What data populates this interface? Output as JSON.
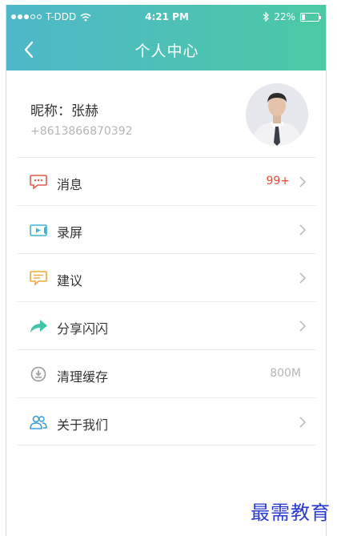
{
  "status_bar": {
    "carrier": "T-DDD",
    "time": "4:21 PM",
    "battery": "22%",
    "battery_level": 0.22
  },
  "navbar": {
    "title": "个人中心",
    "back_icon": "chevron-left-icon"
  },
  "profile": {
    "nickname_label": "昵称：",
    "nickname": "张赫",
    "phone": "+8613866870392"
  },
  "menu": [
    {
      "label": "消息",
      "icon": "message-icon",
      "value": "99+",
      "chevron": true
    },
    {
      "label": "录屏",
      "icon": "screen-record-icon",
      "value": "",
      "chevron": true
    },
    {
      "label": "建议",
      "icon": "suggestion-icon",
      "value": "",
      "chevron": true
    },
    {
      "label": "分享闪闪",
      "icon": "share-icon",
      "value": "",
      "chevron": true
    },
    {
      "label": "清理缓存",
      "icon": "clear-cache-icon",
      "value": "800M",
      "chevron": false
    },
    {
      "label": "关于我们",
      "icon": "about-us-icon",
      "value": "",
      "chevron": true
    }
  ],
  "colors": {
    "header_gradient_start": "#4fb7c9",
    "header_gradient_end": "#4cc9a4",
    "badge": "#e24c2f",
    "message_icon": "#e05a4e",
    "record_icon": "#3eb4d6",
    "suggestion_icon": "#f0a83a",
    "share_icon": "#3ec4a6",
    "cache_icon": "#9a9a9a",
    "about_icon": "#3a9be0"
  },
  "watermark": "最需教育"
}
